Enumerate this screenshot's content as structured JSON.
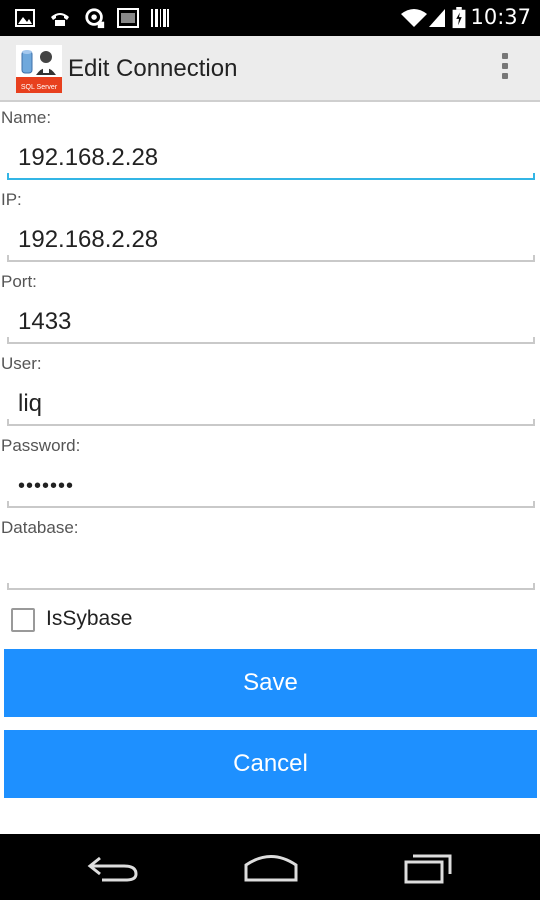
{
  "status_bar": {
    "time": "10:37",
    "icons": [
      "image-icon",
      "voicemail-icon",
      "sync-icon",
      "sim-icon",
      "barcode-icon",
      "wifi-icon",
      "signal-icon",
      "battery-icon"
    ]
  },
  "action_bar": {
    "title": "Edit Connection",
    "app_icon_text": "SQL Server"
  },
  "form": {
    "name_label": "Name:",
    "name_value": "192.168.2.28",
    "ip_label": "IP:",
    "ip_value": "192.168.2.28",
    "port_label": "Port:",
    "port_value": "1433",
    "user_label": "User:",
    "user_value": "liq",
    "password_label": "Password:",
    "password_value": "•••••••",
    "database_label": "Database:",
    "database_value": "",
    "issybase_label": "IsSybase",
    "issybase_checked": false
  },
  "buttons": {
    "save": "Save",
    "cancel": "Cancel"
  },
  "colors": {
    "accent": "#1e90ff",
    "focus_line": "#33b5e5",
    "action_bar_bg": "#ececec"
  }
}
